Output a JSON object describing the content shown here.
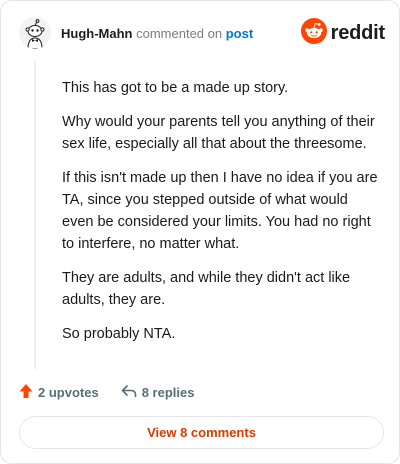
{
  "header": {
    "author": "Hugh-Mahn",
    "commented_on": "commented on",
    "post_link": "post",
    "brand": "reddit",
    "avatar_icon": "snoo-avatar-icon",
    "brand_icon": "reddit-logo-icon",
    "brand_color": "#ff4500"
  },
  "comment": {
    "paragraphs": [
      "This has got to be a made up story.",
      "Why would your parents tell you anything of their sex life, especially all that about the threesome.",
      "If this isn't made up then I have no idea if you are TA, since you stepped outside of what would even be considered your limits. You had no right to interfere, no matter what.",
      "They are adults, and while they didn't act like adults, they are.",
      "So probably NTA."
    ]
  },
  "actions": {
    "upvotes": "2 upvotes",
    "replies": "8 replies",
    "upvote_icon": "upvote-arrow-icon",
    "reply_icon": "reply-arrow-icon",
    "upvote_color": "#ff4500"
  },
  "footer": {
    "view_comments": "View 8 comments",
    "accent_color": "#d93a00"
  }
}
